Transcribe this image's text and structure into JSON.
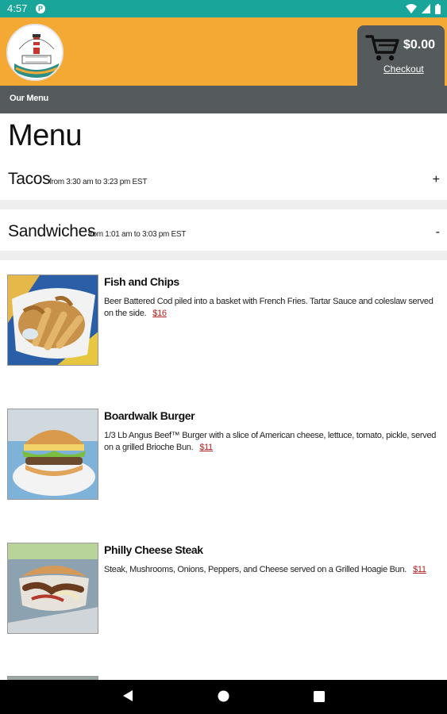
{
  "status_bar": {
    "time": "4:57",
    "app_icon": "P"
  },
  "header": {
    "logo_alt": "Boardwalk Grill",
    "cart_total": "$0.00",
    "checkout_label": "Checkout",
    "color": "#f4a934"
  },
  "nav": {
    "item": "Our Menu"
  },
  "page": {
    "title": "Menu"
  },
  "sections": [
    {
      "name": "Tacos",
      "hours": "from 3:30 am to 3:23 pm EST",
      "toggle": "+"
    },
    {
      "name": "Sandwiches",
      "hours": "from 1:01 am to 3:03 pm EST",
      "toggle": "-"
    }
  ],
  "items": [
    {
      "name": "Fish and Chips",
      "description": "Beer Battered Cod piled into a basket with French Fries. Tartar Sauce and coleslaw served on the side.",
      "price": "$16",
      "thumb": "fish-and-chips-photo"
    },
    {
      "name": "Boardwalk Burger",
      "description": "1/3 Lb Angus Beef™ Burger with a slice of American cheese, lettuce, tomato, pickle, served on a grilled Brioche Bun.",
      "price": "$11",
      "thumb": "burger-photo"
    },
    {
      "name": "Philly Cheese Steak",
      "description": "Steak, Mushrooms, Onions, Peppers, and Cheese served on a Grilled Hoagie Bun.",
      "price": "$11",
      "thumb": "cheesesteak-photo"
    }
  ],
  "colors": {
    "status": "#1aa59a",
    "header": "#f4a934",
    "nav": "#555b5d",
    "price": "#b32020"
  }
}
